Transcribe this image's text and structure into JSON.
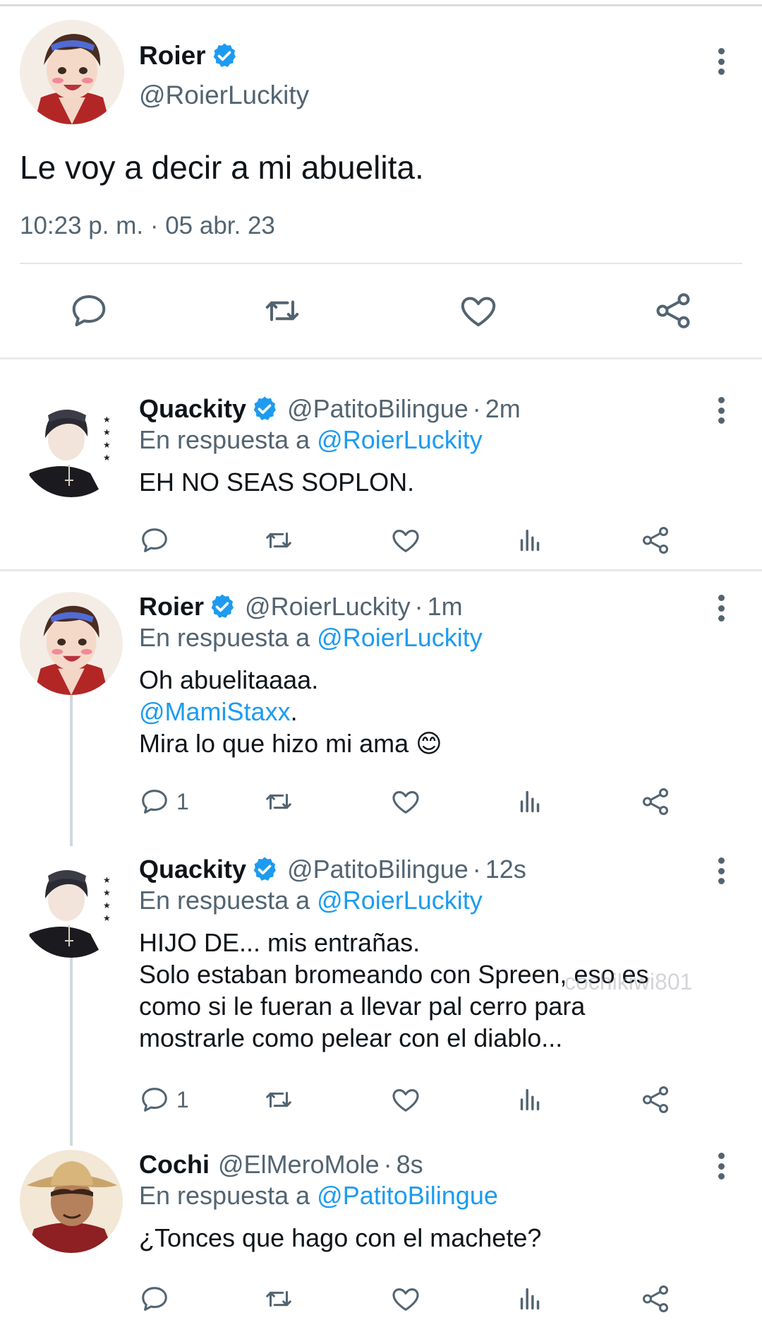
{
  "main_tweet": {
    "name": "Roier",
    "handle": "@RoierLuckity",
    "text": "Le voy a decir a mi abuelita.",
    "timestamp": "10:23 p. m. · 05 abr. 23",
    "actions": [
      "reply-icon",
      "retweet-icon",
      "like-icon",
      "share-icon"
    ]
  },
  "replies": [
    {
      "name": "Quackity",
      "verified": true,
      "handle": "@PatitoBilingue",
      "ago": "2m",
      "in_reply_prefix": "En respuesta a",
      "in_reply_to": "@RoierLuckity",
      "lines": [
        "EH NO SEAS SOPLON."
      ],
      "reply_count": ""
    },
    {
      "name": "Roier",
      "verified": true,
      "handle": "@RoierLuckity",
      "ago": "1m",
      "in_reply_prefix": "En respuesta a",
      "in_reply_to": "@RoierLuckity",
      "lines": [
        "Oh abuelitaaaa.",
        "@MamiStaxx",
        ".",
        "Mira lo que hizo mi ama 😊"
      ],
      "reply_count": "1"
    },
    {
      "name": "Quackity",
      "verified": true,
      "handle": "@PatitoBilingue",
      "ago": "12s",
      "in_reply_prefix": "En respuesta a",
      "in_reply_to": "@RoierLuckity",
      "lines": [
        "HIJO DE... mis entrañas.",
        "Solo estaban bromeando con Spreen, eso es",
        "como si le fueran a llevar pal cerro para",
        "mostrarle como pelear con el diablo..."
      ],
      "reply_count": "1"
    },
    {
      "name": "Cochi",
      "verified": false,
      "handle": "@ElMeroMole",
      "ago": "8s",
      "in_reply_prefix": "En respuesta a",
      "in_reply_to": "@PatitoBilingue",
      "lines": [
        "¿Tonces que hago con el machete?"
      ],
      "reply_count": ""
    }
  ],
  "separator_dot": "·",
  "watermark": "cochikiwi801",
  "colors": {
    "link": "#1d9bf0",
    "muted": "#536471",
    "text": "#0f1419",
    "divider": "#e6eaed"
  }
}
